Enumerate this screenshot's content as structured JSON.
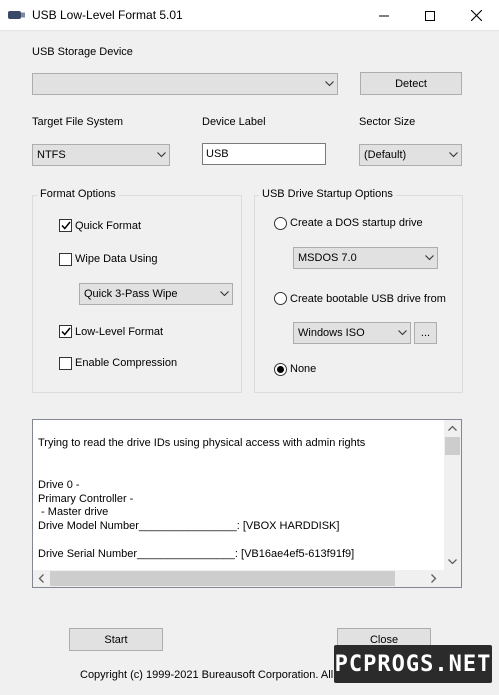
{
  "window": {
    "title": "USB Low-Level Format 5.01"
  },
  "storage": {
    "label": "USB Storage Device",
    "selected": "",
    "detect_label": "Detect"
  },
  "filesystem": {
    "label": "Target File System",
    "selected": "NTFS"
  },
  "device_label": {
    "label": "Device Label",
    "value": "USB"
  },
  "sector": {
    "label": "Sector Size",
    "selected": "(Default)"
  },
  "format_options": {
    "title": "Format Options",
    "quick_format": {
      "label": "Quick Format",
      "checked": true
    },
    "wipe_data": {
      "label": "Wipe Data Using",
      "checked": false
    },
    "wipe_method": "Quick 3-Pass Wipe",
    "low_level": {
      "label": "Low-Level Format",
      "checked": true
    },
    "compression": {
      "label": "Enable Compression",
      "checked": false
    }
  },
  "startup_options": {
    "title": "USB Drive Startup Options",
    "dos_radio": {
      "label": "Create a DOS startup drive",
      "selected": false
    },
    "dos_version": "MSDOS 7.0",
    "bootable_radio": {
      "label": "Create bootable USB drive from",
      "selected": false
    },
    "bootable_source": "Windows ISO",
    "browse_label": "...",
    "none_radio": {
      "label": "None",
      "selected": true
    }
  },
  "log": {
    "lines": [
      "Trying to read the drive IDs using physical access with admin rights",
      "Drive 0 -",
      "Primary Controller -",
      " - Master drive",
      "Drive Model Number________________: [VBOX HARDDISK]",
      "Drive Serial Number________________: [VB16ae4ef5-613f91f9]"
    ]
  },
  "actions": {
    "start_label": "Start",
    "close_label": "Close"
  },
  "footer": {
    "copyright": "Copyright (c) 1999-2021 Bureausoft Corporation. All Rights Reserved."
  },
  "watermark": "PCPROGS.NET"
}
